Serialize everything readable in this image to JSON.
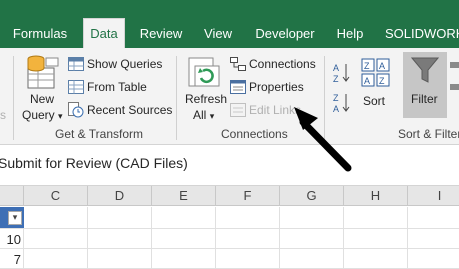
{
  "tabs": [
    {
      "label": "Formulas",
      "active": false
    },
    {
      "label": "Data",
      "active": true
    },
    {
      "label": "Review",
      "active": false
    },
    {
      "label": "View",
      "active": false
    },
    {
      "label": "Developer",
      "active": false
    },
    {
      "label": "Help",
      "active": false
    },
    {
      "label": "SOLIDWORKS",
      "active": false
    }
  ],
  "ribbon": {
    "get_transform": {
      "new_query_line1": "New",
      "new_query_line2": "Query",
      "show_queries": "Show Queries",
      "from_table": "From Table",
      "recent_sources": "Recent Sources",
      "group_label": "Get & Transform"
    },
    "connections": {
      "refresh_line1": "Refresh",
      "refresh_line2": "All",
      "connections": "Connections",
      "properties": "Properties",
      "edit_links": "Edit Links",
      "group_label": "Connections"
    },
    "sort_filter": {
      "sort": "Sort",
      "filter": "Filter",
      "group_label": "Sort & Filter"
    },
    "left_cut": "s"
  },
  "formula_bar": {
    "text": "Submit for Review (CAD Files)"
  },
  "columns": [
    "C",
    "D",
    "E",
    "F",
    "G",
    "H",
    "I"
  ],
  "cells": {
    "row1_value": "10",
    "row2_value": "7"
  },
  "colors": {
    "accent": "#217346",
    "ribbon_bg": "#f3f3f3",
    "arrow": "#000000"
  }
}
